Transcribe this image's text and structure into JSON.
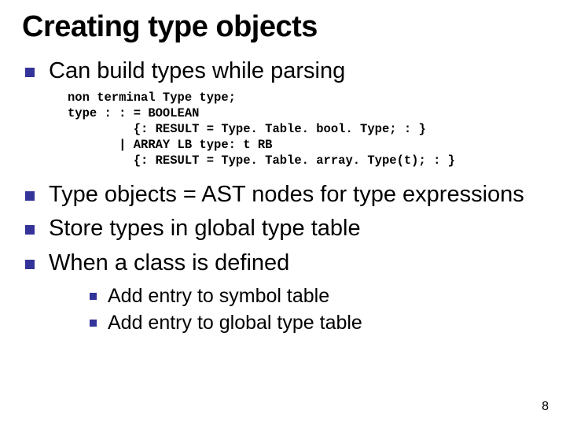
{
  "title": "Creating type objects",
  "bullets1": {
    "b0": "Can build types while parsing",
    "b1": "Type objects = AST nodes for type expressions",
    "b2": "Store types in global type table",
    "b3": "When a class is defined"
  },
  "code": "non terminal Type type;\ntype : : = BOOLEAN\n         {: RESULT = Type. Table. bool. Type; : }\n       | ARRAY LB type: t RB\n         {: RESULT = Type. Table. array. Type(t); : }",
  "bullets2": {
    "b0": "Add entry to symbol table",
    "b1": "Add entry to global type table"
  },
  "page_number": "8"
}
